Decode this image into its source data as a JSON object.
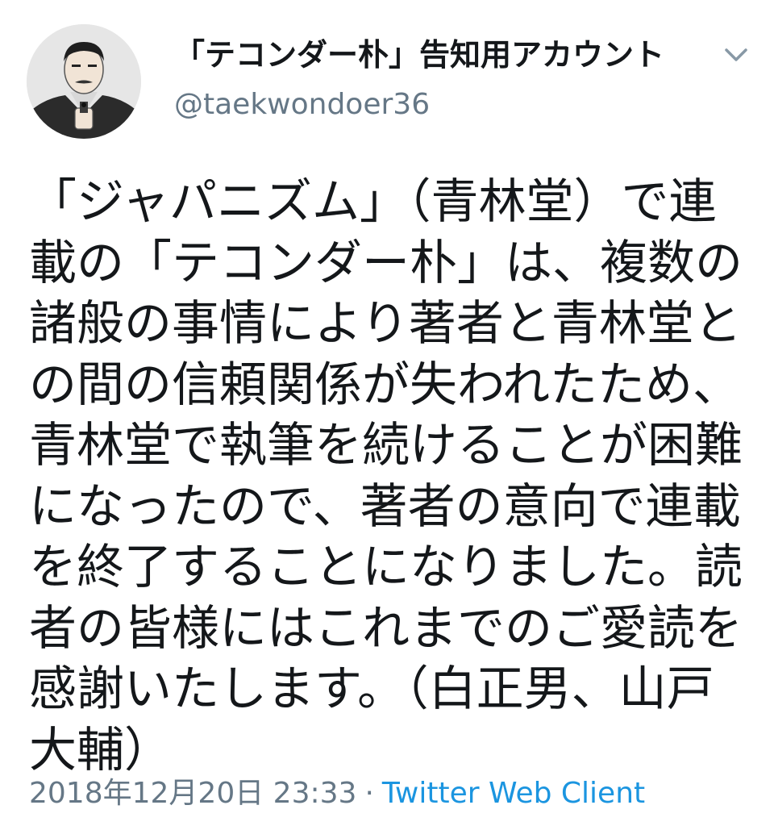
{
  "tweet": {
    "author": {
      "display_name": "「テコンダー朴」告知用アカウント",
      "handle": "@taekwondoer36",
      "avatar_icon": "avatar-illustration-icon"
    },
    "menu_icon": "chevron-down-icon",
    "text": "「ジャパニズム」（青林堂）で連載の「テコンダー朴」は、複数の諸般の事情により著者と青林堂との間の信頼関係が失われたため、青林堂で執筆を続けることが困難になったので、著者の意向で連載を終了することになりました。読者の皆様にはこれまでのご愛読を感謝いたします。（白正男、山戸大輔）",
    "timestamp": "2018年12月20日 23:33",
    "separator": "·",
    "client": "Twitter Web Client"
  },
  "colors": {
    "text_primary": "#14171a",
    "text_secondary": "#657786",
    "link": "#1b95e0"
  }
}
